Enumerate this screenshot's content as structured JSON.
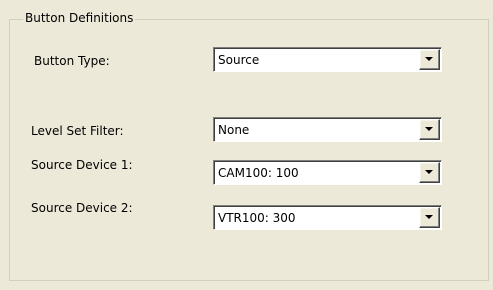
{
  "group": {
    "title": "Button Definitions"
  },
  "fields": {
    "button_type": {
      "label": "Button Type:",
      "value": "Source",
      "icon": "chevron-down-icon"
    },
    "level_set_filter": {
      "label": "Level Set Filter:",
      "value": "None",
      "icon": "chevron-down-icon"
    },
    "source_device_1": {
      "label": "Source Device 1:",
      "value": "CAM100: 100",
      "icon": "chevron-down-icon"
    },
    "source_device_2": {
      "label": "Source Device 2:",
      "value": "VTR100: 300",
      "icon": "chevron-down-icon"
    }
  },
  "colors": {
    "dialog_background": "#ece9d8",
    "field_background": "#ffffff"
  }
}
